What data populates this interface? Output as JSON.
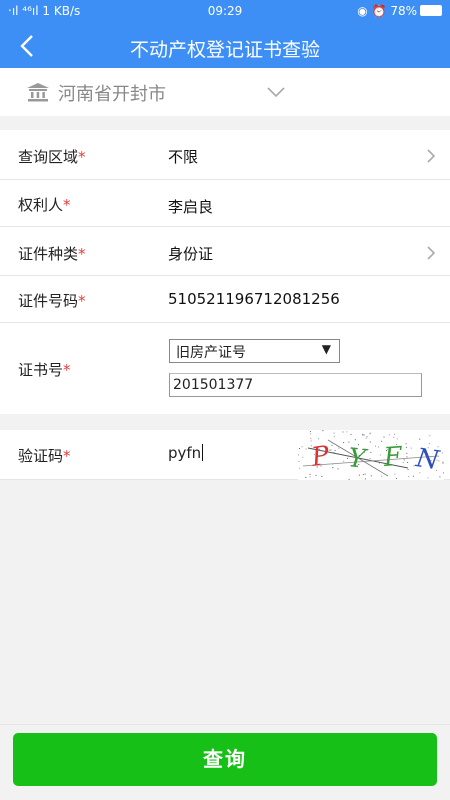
{
  "status_bar": {
    "left": "‧ıl ⁴⁶ıl 1 KB/s",
    "time": "09:29",
    "battery": "◉ ⏰ 78%"
  },
  "header": {
    "title": "不动产权登记证书查验",
    "back_icon": "chevron-left-icon"
  },
  "location": {
    "text": "河南省开封市",
    "icon": "building-icon",
    "dropdown_icon": "chevron-down-icon"
  },
  "form": {
    "region": {
      "label": "查询区域",
      "value": "不限"
    },
    "owner": {
      "label": "权利人",
      "value": "李启良"
    },
    "id_type": {
      "label": "证件种类",
      "value": "身份证"
    },
    "id_number": {
      "label": "证件号码",
      "value": "510521196712081256"
    },
    "cert_number": {
      "label": "证书号",
      "select_value": "旧房产证号",
      "select_caret": "▼",
      "input_value": "201501377"
    },
    "required_mark": "*"
  },
  "captcha": {
    "label": "验证码",
    "input_value": "pyfn",
    "image_text": [
      "P",
      "Y",
      "F",
      "N"
    ],
    "image_colors": [
      "#d93333",
      "#3a9b3a",
      "#3a9b3a",
      "#2f4fc0"
    ]
  },
  "submit": {
    "label": "查询",
    "color": "#16c016"
  },
  "colors": {
    "header": "#3d8ff5",
    "required": "#e63b3b"
  }
}
